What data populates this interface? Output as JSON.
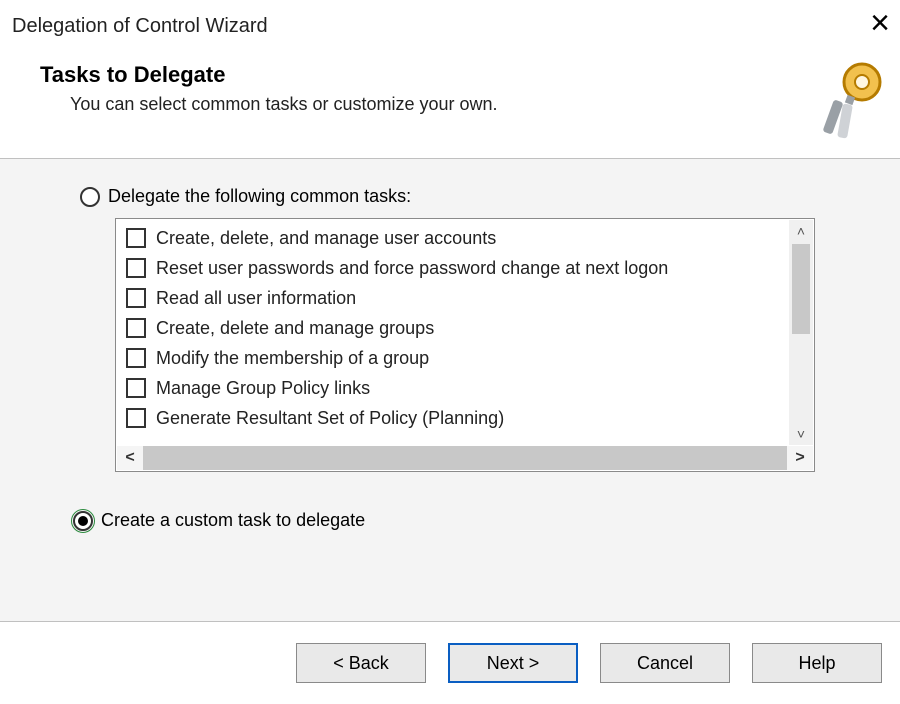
{
  "window": {
    "title": "Delegation of Control Wizard"
  },
  "header": {
    "title": "Tasks to Delegate",
    "subtitle": "You can select common tasks or customize your own."
  },
  "options": {
    "common": {
      "label": "Delegate the following common tasks:",
      "selected": false
    },
    "custom": {
      "label": "Create a custom task to delegate",
      "selected": true
    }
  },
  "tasks": [
    {
      "label": "Create, delete, and manage user accounts",
      "checked": false
    },
    {
      "label": "Reset user passwords and force password change at next logon",
      "checked": false
    },
    {
      "label": "Read all user information",
      "checked": false
    },
    {
      "label": "Create, delete and manage groups",
      "checked": false
    },
    {
      "label": "Modify the membership of a group",
      "checked": false
    },
    {
      "label": "Manage Group Policy links",
      "checked": false
    },
    {
      "label": "Generate Resultant Set of Policy (Planning)",
      "checked": false
    }
  ],
  "buttons": {
    "back": "< Back",
    "next": "Next >",
    "cancel": "Cancel",
    "help": "Help"
  }
}
